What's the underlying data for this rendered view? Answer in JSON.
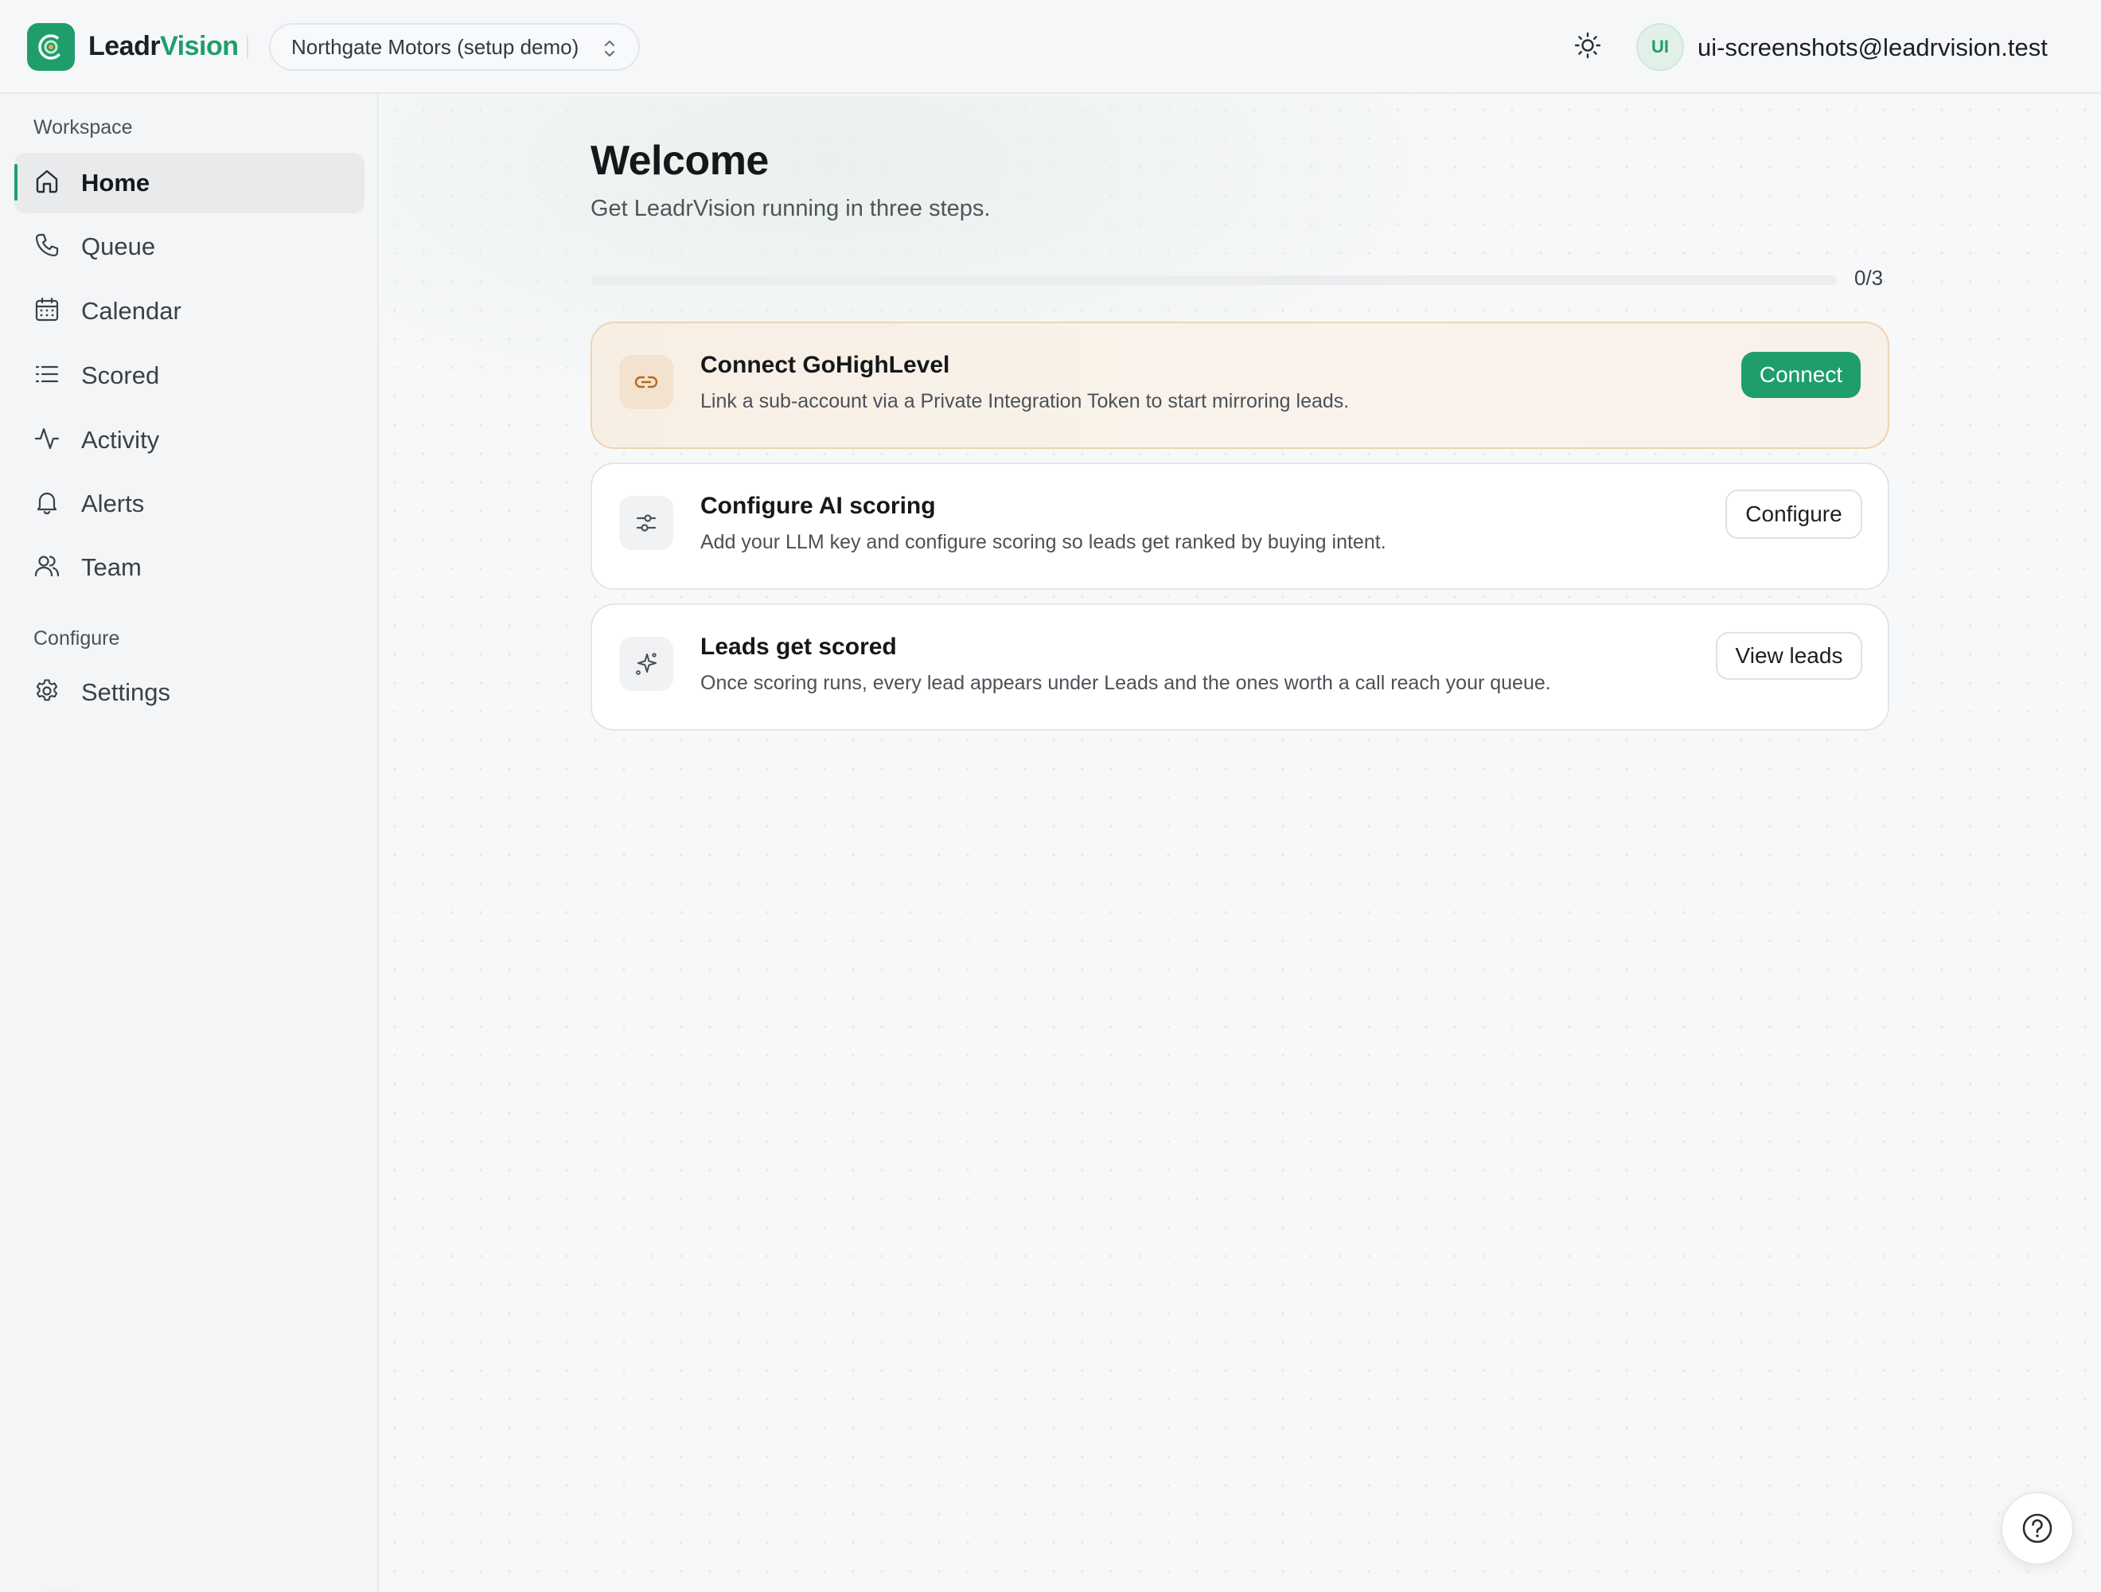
{
  "brand": {
    "name_part1": "Leadr",
    "name_part2": "Vision",
    "accent": "#1f9e6c"
  },
  "header": {
    "account_switcher": {
      "label": "Northgate Motors (setup demo)",
      "icon": "chevron-up-down-icon"
    },
    "theme_toggle": {
      "icon": "sun-icon"
    },
    "user": {
      "initials": "UI",
      "email": "ui-screenshots@leadrvision.test"
    }
  },
  "sidebar": {
    "workspace_label": "Workspace",
    "configure_label": "Configure",
    "items": [
      {
        "label": "Home",
        "icon": "home-icon",
        "active": true
      },
      {
        "label": "Queue",
        "icon": "phone-icon",
        "active": false
      },
      {
        "label": "Calendar",
        "icon": "calendar-icon",
        "active": false
      },
      {
        "label": "Scored",
        "icon": "list-icon",
        "active": false
      },
      {
        "label": "Activity",
        "icon": "activity-icon",
        "active": false
      },
      {
        "label": "Alerts",
        "icon": "bell-icon",
        "active": false
      },
      {
        "label": "Team",
        "icon": "users-icon",
        "active": false
      }
    ],
    "configure_items": [
      {
        "label": "Settings",
        "icon": "gear-icon",
        "active": false
      }
    ],
    "dev_badge": {
      "label": "N"
    }
  },
  "main": {
    "title": "Welcome",
    "subtitle": "Get LeadrVision running in three steps.",
    "progress": {
      "completed": 0,
      "total": 3,
      "text": "0/3"
    },
    "steps": [
      {
        "title": "Connect GoHighLevel",
        "description": "Link a sub-account via a Private Integration Token to start mirroring leads.",
        "button": "Connect",
        "icon": "link-icon",
        "current": true
      },
      {
        "title": "Configure AI scoring",
        "description": "Add your LLM key and configure scoring so leads get ranked by buying intent.",
        "button": "Configure",
        "icon": "sliders-icon",
        "current": false
      },
      {
        "title": "Leads get scored",
        "description": "Once scoring runs, every lead appears under Leads and the ones worth a call reach your queue.",
        "button": "View leads",
        "icon": "sparkles-icon",
        "current": false
      }
    ]
  },
  "help": {
    "icon": "help-circle-icon"
  }
}
